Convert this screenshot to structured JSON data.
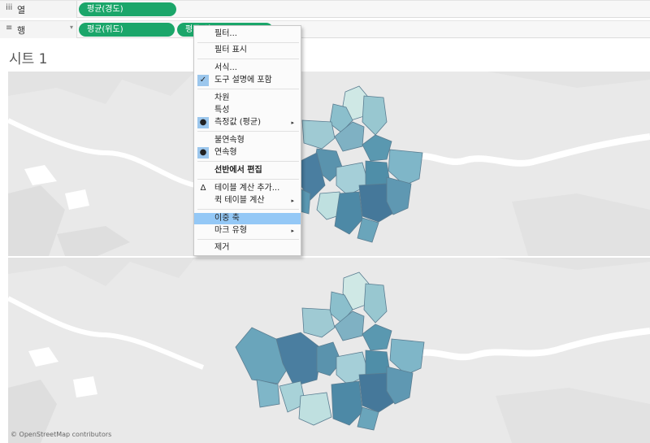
{
  "shelves": {
    "columns": {
      "icon": "iii",
      "label": "열",
      "pills": [
        "평균(경도)"
      ]
    },
    "rows": {
      "icon": "≡",
      "label": "행",
      "caret": "▾",
      "pills": [
        "평균(위도)",
        "평균(위도)"
      ]
    }
  },
  "sheet": {
    "title": "시트 1"
  },
  "map": {
    "attribution": "© OpenStreetMap contributors"
  },
  "context_menu": {
    "items": [
      {
        "label": "필터..."
      },
      {
        "label": "필터 표시"
      },
      {
        "label": "서식..."
      },
      {
        "label": "도구 설명에 포함",
        "checked": true
      },
      {
        "label": "차원"
      },
      {
        "label": "특성"
      },
      {
        "label": "측정값 (평균)",
        "selected": true,
        "submenu": true
      },
      {
        "label": "불연속형"
      },
      {
        "label": "연속형",
        "selected": true
      },
      {
        "label": "선반에서 편집",
        "bold": true
      },
      {
        "label": "테이블 계산 추가..."
      },
      {
        "label": "퀵 테이블 계산",
        "submenu": true
      },
      {
        "label": "이중 축",
        "highlighted": true
      },
      {
        "label": "마크 유형",
        "submenu": true
      },
      {
        "label": "제거"
      }
    ],
    "marks": {
      "check": "✓",
      "dot": "●",
      "delta": "Δ",
      "arrow": "▸"
    }
  },
  "colors": {
    "pill": "#1ba66a",
    "highlight": "#94c8f6",
    "map_background": "#e9e9e9",
    "water": "#ffffff",
    "district_light": "#cde7e6",
    "district_dark": "#3f6e92"
  },
  "icons": {
    "columns_shelf": "columns-icon",
    "rows_shelf": "rows-icon",
    "check": "check-icon",
    "selected": "dot-icon",
    "calc": "delta-icon",
    "submenu": "submenu-arrow-icon"
  }
}
